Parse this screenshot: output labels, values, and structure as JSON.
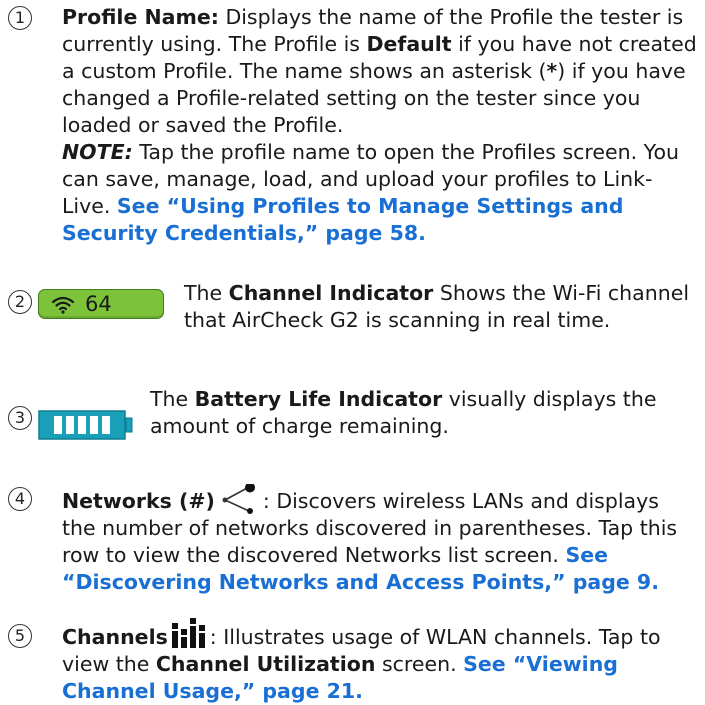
{
  "items": [
    {
      "number": "1",
      "label": "Profile Name:",
      "t1": " Displays the name of the Profile the tester is currently using. The Profile is ",
      "default_word": "Default",
      "t2": " if you have not created a custom Profile. The name shows an asterisk (",
      "asterisk": "*",
      "t3": ") if you have changed a Profile-related setting on the tester since you loaded or saved the Profile.",
      "note_label": "NOTE:",
      "note_text": " Tap the profile name to open the Profiles screen. You can save, manage, load, and upload your profiles to Link-Live. ",
      "link": "See “Using Profiles to Manage Settings and Security Credentials,” page 58."
    },
    {
      "number": "2",
      "indicator_value": "64",
      "t1": "The ",
      "label": "Channel Indicator",
      "t2": " Shows the Wi-Fi channel that AirCheck G2 is scanning in real time."
    },
    {
      "number": "3",
      "t1": "The ",
      "label": "Battery Life Indicator",
      "t2": " visually displays the amount of charge remaining."
    },
    {
      "number": "4",
      "label": "Networks (#)",
      "icon": "share-network-icon",
      "t1": ": Discovers wireless LANs and displays the number of networks discovered in parentheses. Tap this row to view the discovered Networks list screen. ",
      "link": "See “Discovering Networks and Access Points,” page 9."
    },
    {
      "number": "5",
      "label": "Channels",
      "icon": "bar-chart-icon",
      "t1": ": Illustrates usage of WLAN channels. Tap to view the ",
      "label2": "Channel Utilization",
      "t2": " screen. ",
      "link": "See “Viewing Channel Usage,” page 21."
    }
  ],
  "colors": {
    "link": "#1a6fd4",
    "channel_indicator": "#7cc33a",
    "battery": "#1a9fb8"
  }
}
